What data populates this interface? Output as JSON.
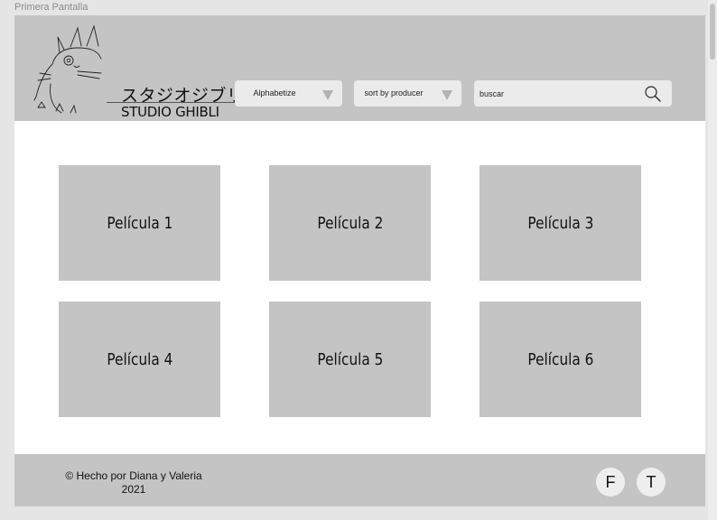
{
  "frame": {
    "title": "Primera Pantalla"
  },
  "header": {
    "logo": {
      "japanese": "スタジオジブリ",
      "english": "STUDIO GHIBLI",
      "icon": "totoro-icon"
    },
    "sort_alpha": {
      "label": "Alphabetize",
      "icon": "triangle-down-icon"
    },
    "sort_producer": {
      "label": "sort by producer",
      "icon": "triangle-down-icon"
    },
    "search": {
      "placeholder": "buscar",
      "icon": "magnifier-icon"
    }
  },
  "cards": [
    {
      "label": "Película 1"
    },
    {
      "label": "Película 2"
    },
    {
      "label": "Película 3"
    },
    {
      "label": "Película 4"
    },
    {
      "label": "Película 5"
    },
    {
      "label": "Película 6"
    }
  ],
  "footer": {
    "credit": "© Hecho por Diana y Valeria",
    "year": "2021",
    "social": [
      {
        "label": "F"
      },
      {
        "label": "T"
      }
    ]
  },
  "colors": {
    "panel_gray": "#c4c4c4",
    "control_bg": "#ebebeb",
    "page_bg": "#ffffff",
    "canvas_bg": "#e5e5e5"
  }
}
